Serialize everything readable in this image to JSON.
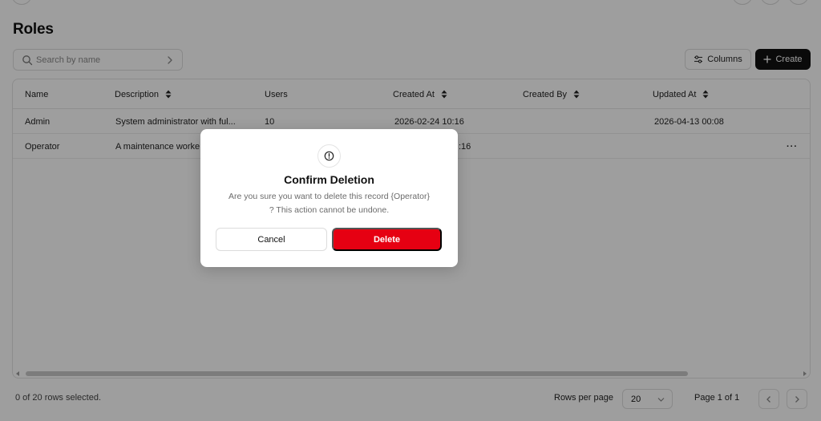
{
  "page": {
    "title": "Roles"
  },
  "search": {
    "placeholder": "Search by name"
  },
  "toolbar": {
    "columns_label": "Columns",
    "create_label": "Create"
  },
  "table": {
    "columns": [
      "Name",
      "Description",
      "Users",
      "Created At",
      "Created By",
      "Updated At"
    ],
    "rows": [
      {
        "name": "Admin",
        "description": "System administrator with ful...",
        "users": "10",
        "created_at": "2026-02-24 10:16",
        "created_by": "",
        "updated_at": "2026-04-13 00:08"
      },
      {
        "name": "Operator",
        "description": "A maintenance worke",
        "users": "",
        "created_at": ":16",
        "created_by": "",
        "updated_at": "",
        "actions": "···"
      }
    ]
  },
  "footer": {
    "selection": "0 of 20 rows selected.",
    "rows_per_page_label": "Rows per page",
    "rows_per_page_value": "20",
    "page_indicator": "Page 1 of 1"
  },
  "dialog": {
    "title": "Confirm Deletion",
    "message_line1": "Are you sure you want to delete this record {Operator}",
    "message_line2": "? This action cannot be undone.",
    "cancel_label": "Cancel",
    "delete_label": "Delete"
  },
  "colors": {
    "danger": "#e60012",
    "primary_dark": "#111111",
    "overlay": "rgba(0,0,0,0.38)"
  },
  "icons": [
    "search-icon",
    "chevron-right-icon",
    "columns-settings-icon",
    "plus-icon",
    "sort-icon",
    "more-horizontal-icon",
    "chevron-down-icon",
    "chevron-left-icon",
    "alert-circle-icon"
  ]
}
